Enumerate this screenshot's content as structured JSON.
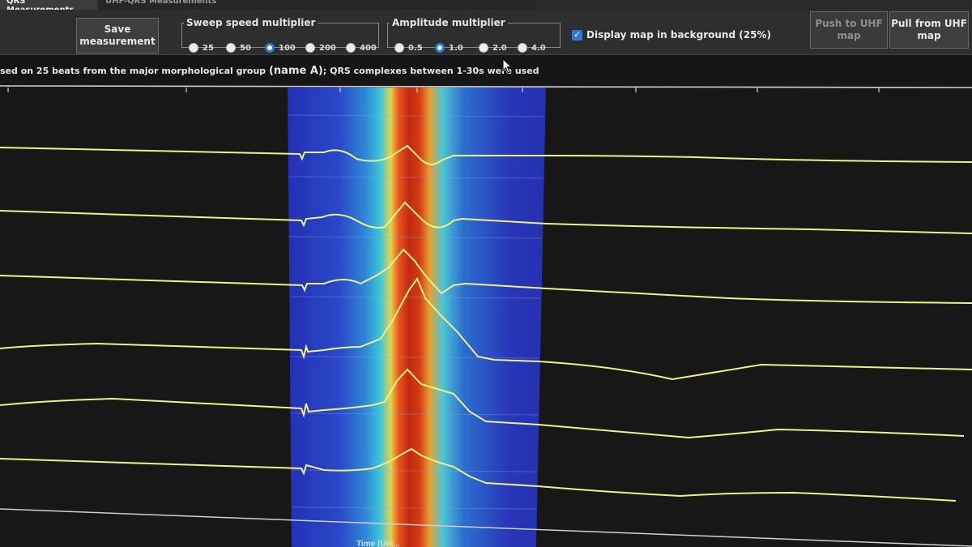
{
  "tabs": [
    {
      "label": "QRS Measurements",
      "active": true
    },
    {
      "label": "UHF-QRS Measurements",
      "active": false
    }
  ],
  "toolbar": {
    "save_label": "Save\nmeasurement",
    "sweep_group": {
      "legend": "Sweep speed multiplier",
      "options": [
        "25",
        "50",
        "100",
        "200",
        "400"
      ],
      "selected": "100"
    },
    "amplitude_group": {
      "legend": "Amplitude multiplier",
      "options": [
        "0.5",
        "1.0",
        "2.0",
        "4.0"
      ],
      "selected": "1.0"
    },
    "display_map_label": "Display map in background (25%)",
    "display_map_checked": true,
    "push_label": "Push to UHF\nmap",
    "pull_label": "Pull from UHF\nmap"
  },
  "info": {
    "prefix": "sed on 25 beats from the major morphological group ",
    "name": "(name A)",
    "suffix": "; QRS complexes between 1-30s were used"
  },
  "axis": {
    "label": "Time (Uni..."
  },
  "colors": {
    "trace": "#eef08a",
    "map_background": "#2a3bb8",
    "map_hot": "#c82a10",
    "accent": "#2f78d8"
  }
}
